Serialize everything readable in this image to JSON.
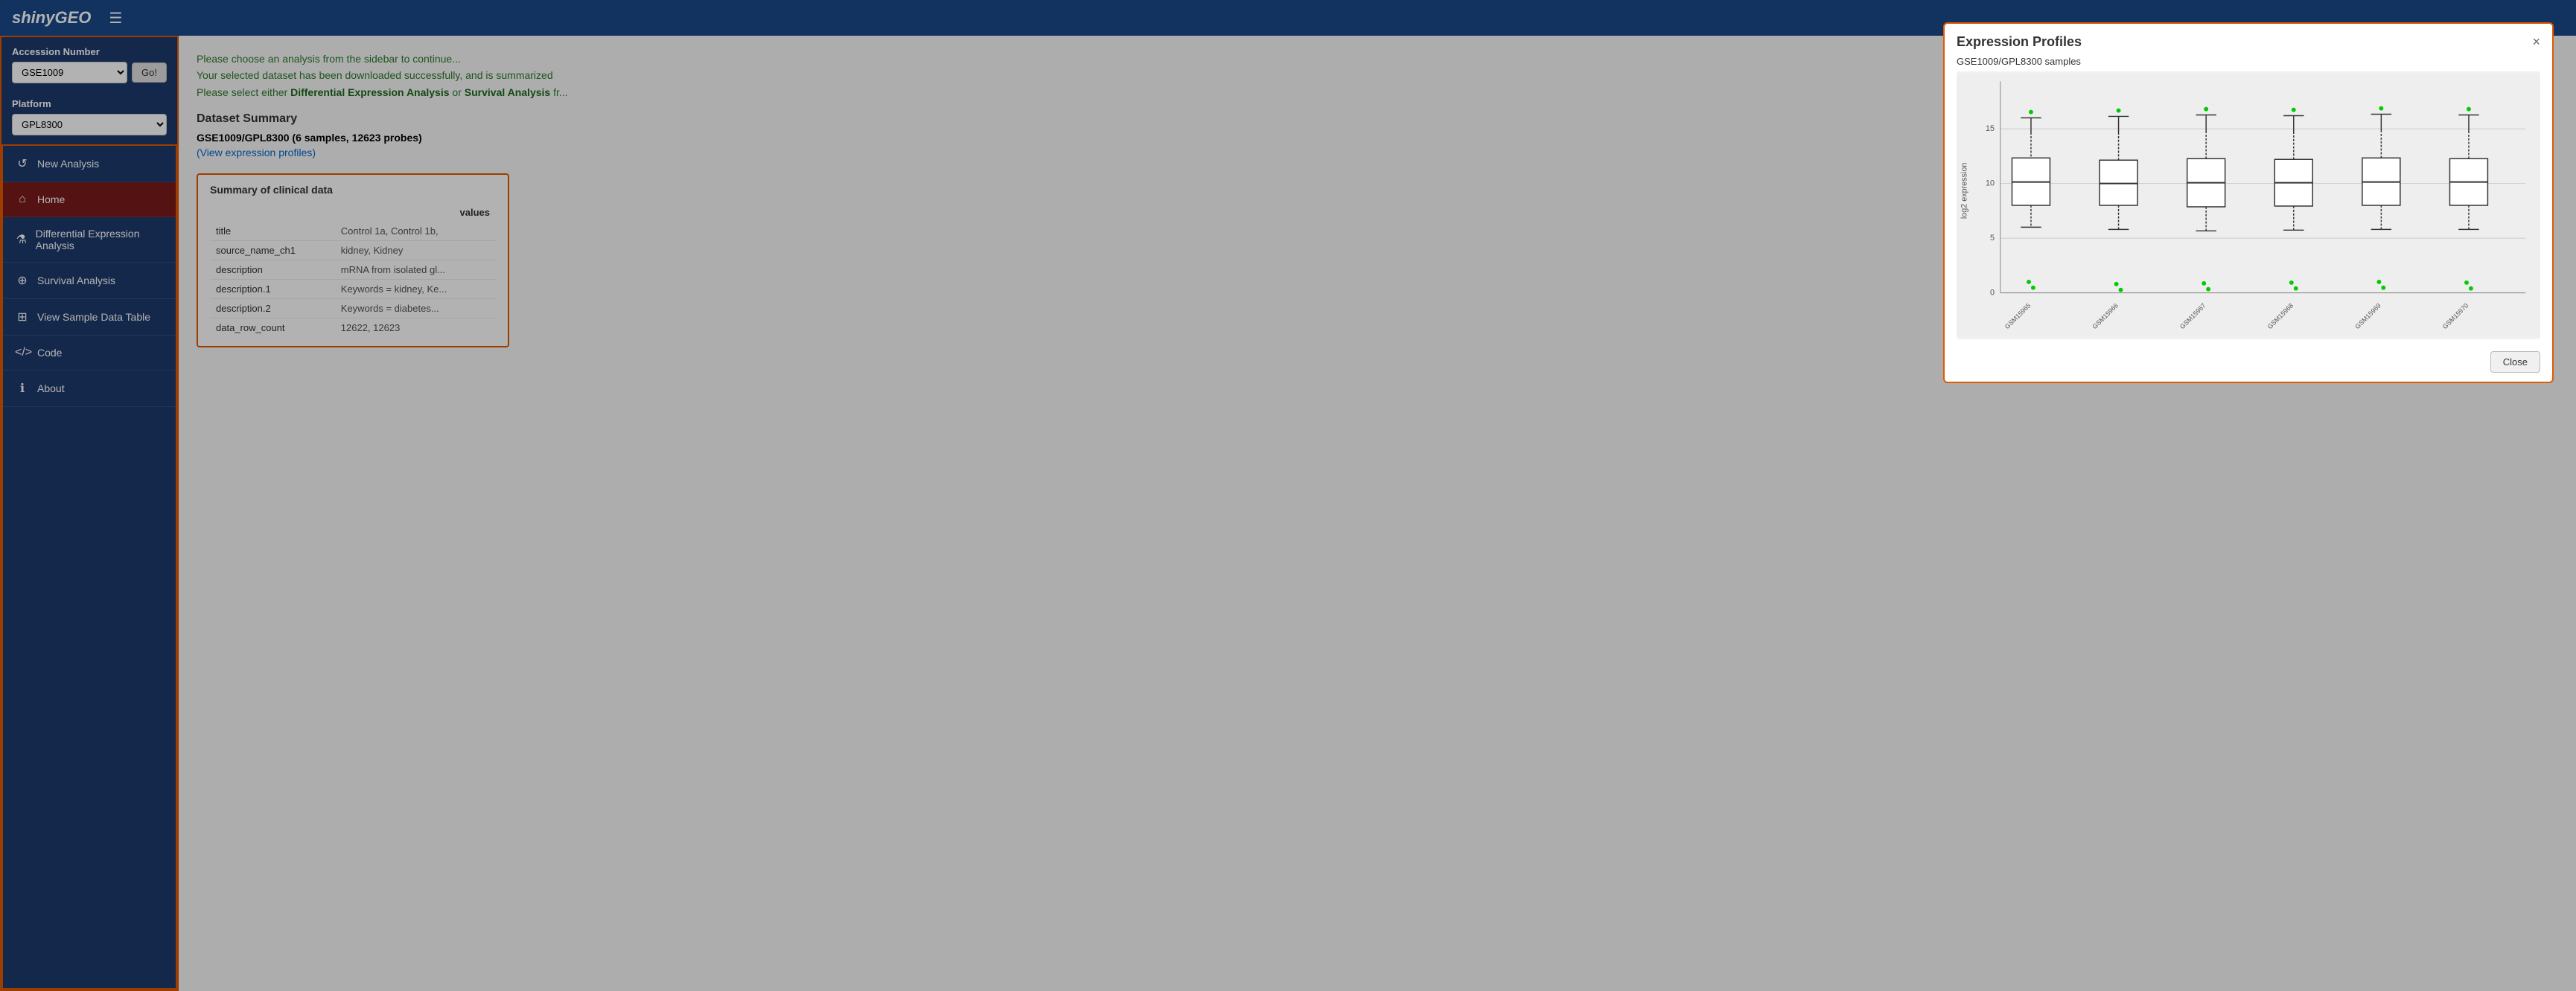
{
  "brand": "shinyGEO",
  "topnav": {
    "hamburger_icon": "☰"
  },
  "sidebar": {
    "accession_label": "Accession Number",
    "accession_value": "GSE1009",
    "go_button": "Go!",
    "platform_label": "Platform",
    "platform_value": "GPL8300",
    "nav_items": [
      {
        "id": "new-analysis",
        "icon": "↺",
        "label": "New Analysis",
        "active": false
      },
      {
        "id": "home",
        "icon": "⌂",
        "label": "Home",
        "active": true
      },
      {
        "id": "diff-expr",
        "icon": "⚗",
        "label": "Differential Expression Analysis",
        "active": false
      },
      {
        "id": "survival",
        "icon": "⊕",
        "label": "Survival Analysis",
        "active": false
      },
      {
        "id": "sample-data",
        "icon": "⊞",
        "label": "View Sample Data Table",
        "active": false
      },
      {
        "id": "code",
        "icon": "⟨⟩",
        "label": "Code",
        "active": false
      },
      {
        "id": "about",
        "icon": "ℹ",
        "label": "About",
        "active": false
      }
    ]
  },
  "content": {
    "info_text": "Please choose an analysis from the sidebar to continue...",
    "info_subtext_1": "Your selected dataset has been downloaded successfully, and is summarized",
    "info_subtext_2": "Please select either",
    "info_highlight_1": "Differential Expression Analysis",
    "info_subtext_3": "or",
    "info_highlight_2": "Survival Analysis",
    "info_subtext_4": "fr...",
    "dataset_summary_heading": "Dataset Summary",
    "dataset_title": "GSE1009/GPL8300 (6 samples, 12623 probes)",
    "view_profiles_link": "(View expression profiles)",
    "clinical_heading": "Summary of clinical data",
    "clinical_col_header": "values",
    "clinical_rows": [
      {
        "field": "title",
        "value": "Control 1a, Control 1b,"
      },
      {
        "field": "source_name_ch1",
        "value": "kidney, Kidney"
      },
      {
        "field": "description",
        "value": "mRNA from isolated gl..."
      },
      {
        "field": "description.1",
        "value": "Keywords = kidney, Ke..."
      },
      {
        "field": "description.2",
        "value": "Keywords = diabetes..."
      },
      {
        "field": "data_row_count",
        "value": "12622, 12623"
      }
    ]
  },
  "modal": {
    "title": "Expression Profiles",
    "subtitle": "GSE1009/GPL8300 samples",
    "yaxis_label": "log2 expression",
    "samples": [
      "GSM15965",
      "GSM15966",
      "GSM15967",
      "GSM15968",
      "GSM15969",
      "GSM15970"
    ],
    "close_button": "Close",
    "close_x": "×",
    "yticks": [
      "0",
      "5",
      "10",
      "15"
    ]
  }
}
